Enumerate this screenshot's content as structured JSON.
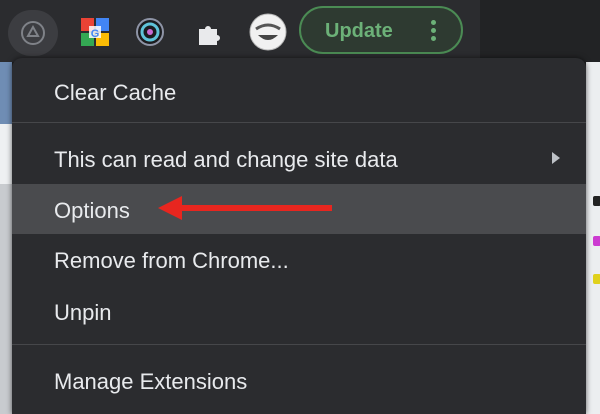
{
  "toolbar": {
    "extensions": [
      {
        "name": "extension-puzzle-icon"
      },
      {
        "name": "google-extension-icon"
      },
      {
        "name": "circle-extension-icon"
      },
      {
        "name": "extensions-puzzle-icon"
      },
      {
        "name": "avatar-face-icon"
      }
    ],
    "update_label": "Update"
  },
  "menu": {
    "items": [
      {
        "label": "Clear Cache"
      },
      {
        "label": "This can read and change site data",
        "has_submenu": true
      },
      {
        "label": "Options",
        "highlighted": true
      },
      {
        "label": "Remove from Chrome..."
      },
      {
        "label": "Unpin"
      },
      {
        "label": "Manage Extensions"
      }
    ]
  },
  "annotation": {
    "type": "red-arrow-icon",
    "color": "#e8261f"
  },
  "colors": {
    "menu_bg": "#2b2c2f",
    "highlight": "#4a4b4e",
    "update_green": "#6cb178",
    "text": "#e8eaed"
  }
}
